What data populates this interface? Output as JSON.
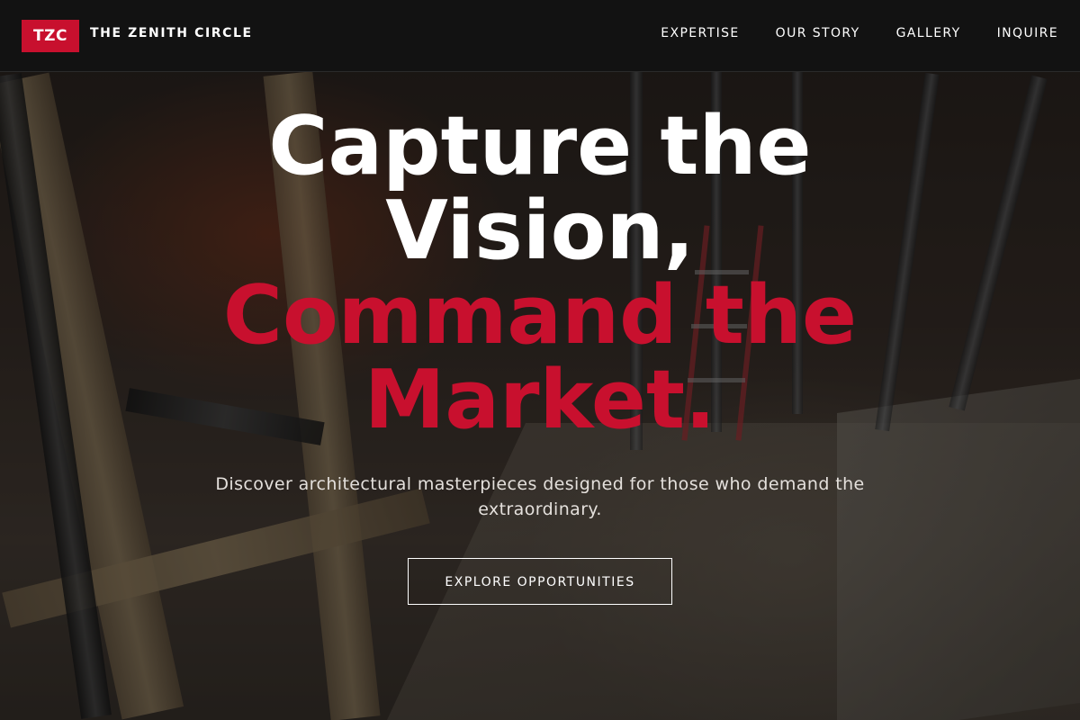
{
  "brand": {
    "logo_text": "TZC",
    "name": "THE ZENITH CIRCLE",
    "accent_color": "#c8102e"
  },
  "nav": {
    "items": [
      {
        "label": "EXPERTISE"
      },
      {
        "label": "OUR STORY"
      },
      {
        "label": "GALLERY"
      },
      {
        "label": "INQUIRE"
      }
    ]
  },
  "hero": {
    "headline_line1": "Capture the",
    "headline_line2": "Vision,",
    "headline_line3": "Command the",
    "headline_line4": "Market.",
    "subtitle": "Discover architectural masterpieces designed for those who demand the extraordinary.",
    "cta_label": "EXPLORE OPPORTUNITIES"
  }
}
